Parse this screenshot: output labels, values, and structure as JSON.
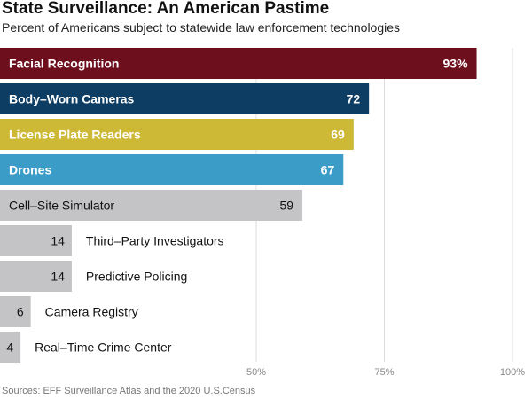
{
  "title": "State Surveillance: An American Pastime",
  "subtitle": "Percent of Americans subject to statewide law enforcement technologies",
  "source": "Sources: EFF Surveillance Atlas and the 2020 U.S.Census",
  "chart_data": {
    "type": "bar",
    "orientation": "horizontal",
    "categories": [
      "Facial Recognition",
      "Body–Worn Cameras",
      "License Plate Readers",
      "Drones",
      "Cell–Site Simulator",
      "Third–Party Investigators",
      "Predictive Policing",
      "Camera Registry",
      "Real–Time Crime Center"
    ],
    "values": [
      93,
      72,
      69,
      67,
      59,
      14,
      14,
      6,
      4
    ],
    "value_labels": [
      "93%",
      "72",
      "69",
      "67",
      "59",
      "14",
      "14",
      "6",
      "4"
    ],
    "xlim": [
      0,
      100
    ],
    "xticks": [
      50,
      75,
      100
    ],
    "xtick_labels": [
      "50%",
      "75%",
      "100%"
    ],
    "grid": "vertical",
    "legend": "none",
    "colors": [
      "#6e0f1e",
      "#0e3d63",
      "#cdb935",
      "#3b9cc8",
      "#c4c4c7",
      "#c4c4c7",
      "#c4c4c7",
      "#c4c4c7",
      "#c4c4c7"
    ],
    "highlighted_bars": [
      0,
      1,
      2,
      3
    ]
  }
}
